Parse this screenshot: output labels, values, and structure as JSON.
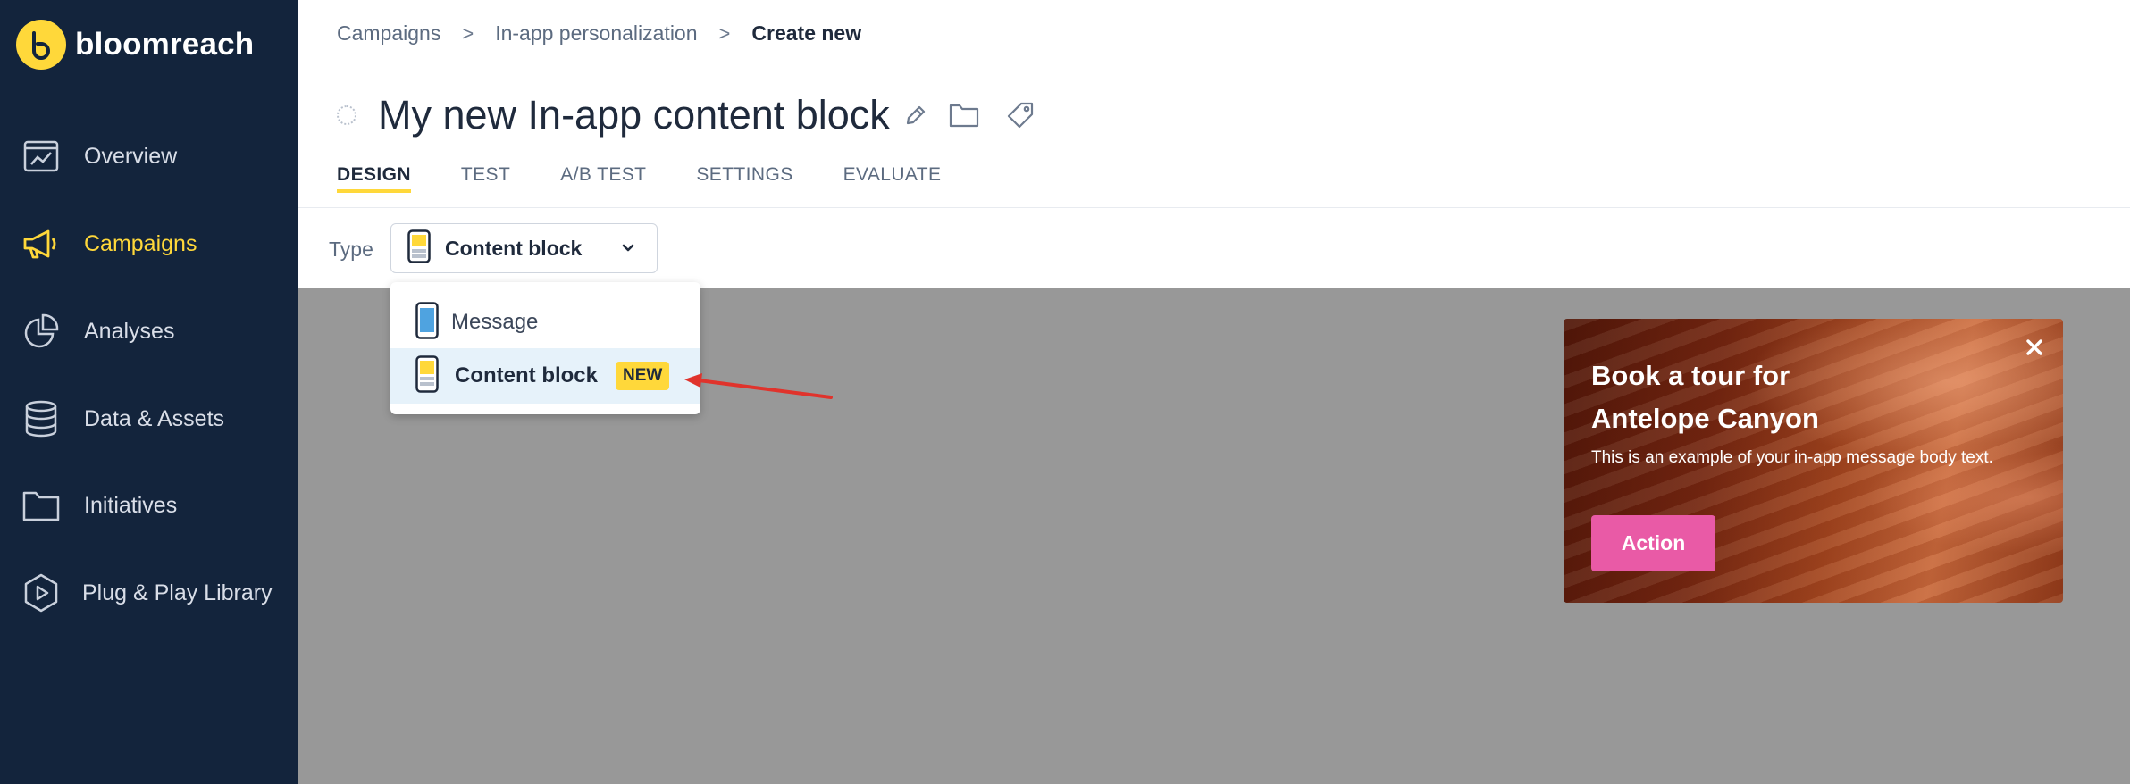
{
  "brand": {
    "name": "bloomreach",
    "accent": "#ffd83a",
    "sidebar_bg": "#13243c"
  },
  "sidebar": {
    "items": [
      {
        "label": "Overview",
        "icon": "overview-icon",
        "active": false
      },
      {
        "label": "Campaigns",
        "icon": "megaphone-icon",
        "active": true
      },
      {
        "label": "Analyses",
        "icon": "pie-chart-icon",
        "active": false
      },
      {
        "label": "Data & Assets",
        "icon": "database-icon",
        "active": false
      },
      {
        "label": "Initiatives",
        "icon": "folder-icon",
        "active": false
      },
      {
        "label": "Plug & Play Library",
        "icon": "play-hexagon-icon",
        "active": false
      }
    ]
  },
  "breadcrumb": {
    "items": [
      "Campaigns",
      "In-app personalization",
      "Create new"
    ],
    "separator": ">"
  },
  "page": {
    "title": "My new In-app content block"
  },
  "tabs": [
    {
      "label": "DESIGN",
      "active": true
    },
    {
      "label": "TEST",
      "active": false
    },
    {
      "label": "A/B TEST",
      "active": false
    },
    {
      "label": "SETTINGS",
      "active": false
    },
    {
      "label": "EVALUATE",
      "active": false
    }
  ],
  "type_field": {
    "label": "Type",
    "selected": "Content block",
    "options": [
      {
        "label": "Message",
        "badge": ""
      },
      {
        "label": "Content block",
        "badge": "NEW"
      }
    ]
  },
  "preview": {
    "title": "Book a tour for Antelope Canyon",
    "body": "This is an example of your in-app message body text.",
    "action_label": "Action",
    "action_color": "#e95aa6"
  }
}
